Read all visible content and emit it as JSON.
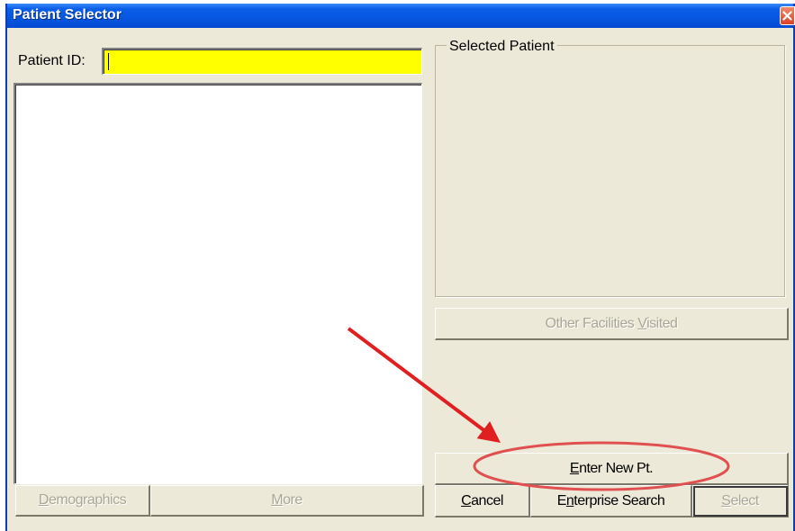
{
  "window": {
    "title": "Patient Selector"
  },
  "form": {
    "patient_id_label": "Patient ID:",
    "patient_id_value": "",
    "selected_patient_legend": "Selected Patient"
  },
  "buttons": {
    "demographics": {
      "pre": "",
      "mn": "D",
      "post": "emographics"
    },
    "more": {
      "pre": "",
      "mn": "M",
      "post": "ore"
    },
    "other_facilities": {
      "pre": "Other Facilities ",
      "mn": "V",
      "post": "isited"
    },
    "enter_new_pt": {
      "pre": "",
      "mn": "E",
      "post": "nter New Pt."
    },
    "cancel": {
      "pre": "",
      "mn": "C",
      "post": "ancel"
    },
    "enterprise_search": {
      "pre": "E",
      "mn": "n",
      "post": "terprise Search"
    },
    "select": {
      "pre": "",
      "mn": "S",
      "post": "elect"
    }
  },
  "annotation": {
    "color": "#e02020"
  },
  "colors": {
    "titlebar": "#0a5ee8",
    "face": "#ece9d8",
    "input_highlight": "#ffff00"
  }
}
